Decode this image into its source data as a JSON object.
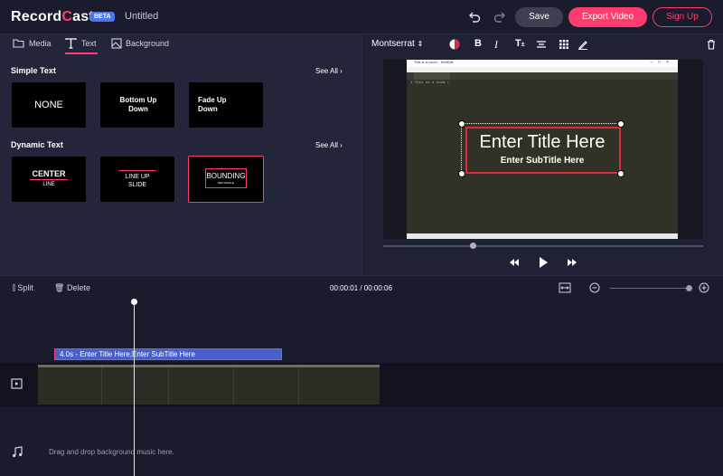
{
  "header": {
    "logo": "RecordCast",
    "logo_pre": "Record",
    "logo_dot": "C",
    "logo_post": "ast",
    "beta": "BETA",
    "doc_title": "Untitled",
    "save": "Save",
    "export": "Export Video",
    "signup": "Sign Up"
  },
  "left_tabs": {
    "media": "Media",
    "text": "Text",
    "background": "Background"
  },
  "simple_text": {
    "title": "Simple Text",
    "see_all": "See All",
    "cards": [
      "NONE",
      "Bottom Up Down",
      "Fade Up Down"
    ]
  },
  "dynamic_text": {
    "title": "Dynamic Text",
    "see_all": "See All",
    "cards": [
      {
        "main": "CENTER",
        "sub": "LINE"
      },
      {
        "main": "LINE UP",
        "sub": "SLIDE"
      },
      {
        "main": "BOUNDING",
        "sub": "RECTANGLE"
      }
    ]
  },
  "text_toolbar": {
    "font": "Montserrat"
  },
  "preview": {
    "editor_window_title": "This is a coom - TextEdit",
    "editor_line": "1  This is a coom |",
    "title_text": "Enter Title Here",
    "subtitle_text": "Enter SubTitle Here",
    "progress": 0.27
  },
  "timeline": {
    "split": "Split",
    "delete": "Delete",
    "time": "00:00:01 / 00:00:06",
    "zoom": 0.95,
    "text_clip": "4.0s - Enter Title Here,Enter SubTitle Here",
    "music_placeholder": "Drag and drop background music here."
  },
  "colors": {
    "accent": "#ff3c6e",
    "beta": "#4a78e8",
    "clip": "#4a5fc8",
    "title_box": "#e02a3c"
  }
}
